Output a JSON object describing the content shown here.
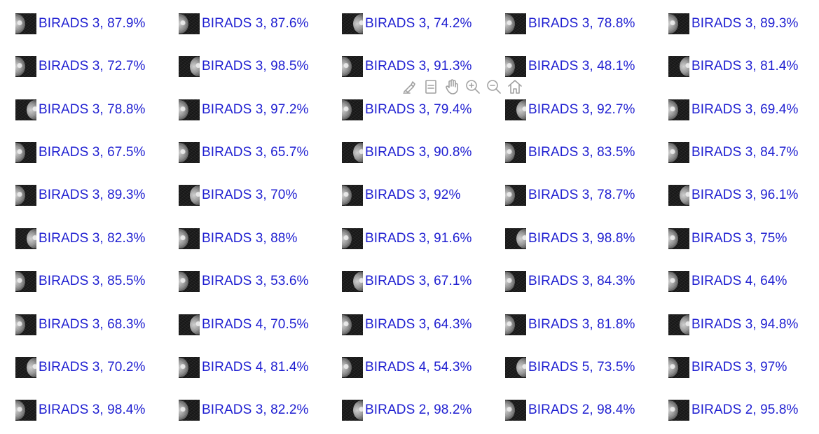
{
  "toolbar": {
    "icons": [
      "brush-icon",
      "datatip-icon",
      "pan-hand-icon",
      "zoom-in-icon",
      "zoom-out-icon",
      "home-icon"
    ]
  },
  "grid": {
    "label_color": "#1f1fd1",
    "rows": [
      [
        "BIRADS 3, 87.9%",
        "BIRADS 3, 87.6%",
        "BIRADS 3, 74.2%",
        "BIRADS 3, 78.8%",
        "BIRADS 3, 89.3%"
      ],
      [
        "BIRADS 3, 72.7%",
        "BIRADS 3, 98.5%",
        "BIRADS 3, 91.3%",
        "BIRADS 3, 48.1%",
        "BIRADS 3, 81.4%"
      ],
      [
        "BIRADS 3, 78.8%",
        "BIRADS 3, 97.2%",
        "BIRADS 3, 79.4%",
        "BIRADS 3, 92.7%",
        "BIRADS 3, 69.4%"
      ],
      [
        "BIRADS 3, 67.5%",
        "BIRADS 3, 65.7%",
        "BIRADS 3, 90.8%",
        "BIRADS 3, 83.5%",
        "BIRADS 3, 84.7%"
      ],
      [
        "BIRADS 3, 89.3%",
        "BIRADS 3, 70%",
        "BIRADS 3, 92%",
        "BIRADS 3, 78.7%",
        "BIRADS 3, 96.1%"
      ],
      [
        "BIRADS 3, 82.3%",
        "BIRADS 3, 88%",
        "BIRADS 3, 91.6%",
        "BIRADS 3, 98.8%",
        "BIRADS 3, 75%"
      ],
      [
        "BIRADS 3, 85.5%",
        "BIRADS 3, 53.6%",
        "BIRADS 3, 67.1%",
        "BIRADS 3, 84.3%",
        "BIRADS 4, 64%"
      ],
      [
        "BIRADS 3, 68.3%",
        "BIRADS 4, 70.5%",
        "BIRADS 3, 64.3%",
        "BIRADS 3, 81.8%",
        "BIRADS 3, 94.8%"
      ],
      [
        "BIRADS 3, 70.2%",
        "BIRADS 4, 81.4%",
        "BIRADS 4, 54.3%",
        "BIRADS 5, 73.5%",
        "BIRADS 3, 97%"
      ],
      [
        "BIRADS 3, 98.4%",
        "BIRADS 3, 82.2%",
        "BIRADS 2, 98.2%",
        "BIRADS 2, 98.4%",
        "BIRADS 2, 95.8%"
      ]
    ]
  }
}
